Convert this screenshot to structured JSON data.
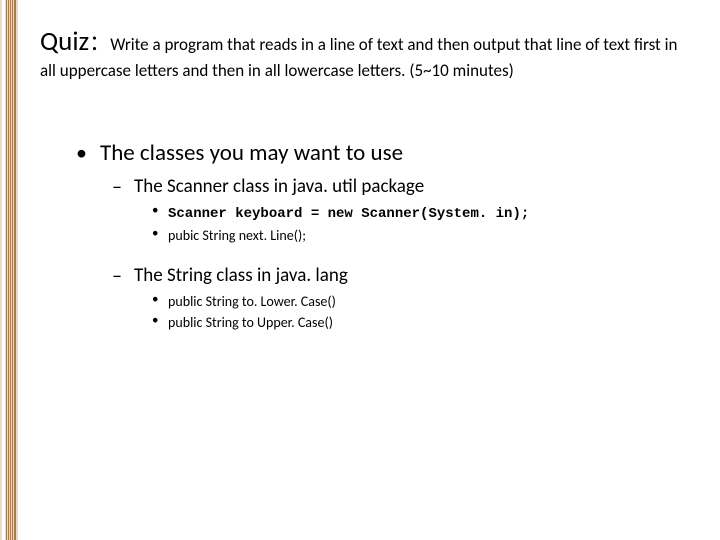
{
  "title": {
    "label": "Quiz",
    "colon": "：",
    "description": "Write a program that reads in a line of text and then output that line of text first in all uppercase letters and then in all lowercase letters. (5~10 minutes)"
  },
  "bullets": {
    "main": "The classes you may want to use",
    "sub1": {
      "head": "The Scanner class in java. util package",
      "code": "Scanner keyboard = new Scanner(System. in);",
      "item2": "pubic String next. Line();"
    },
    "sub2": {
      "head": "The String class in java. lang",
      "item1": "public String to. Lower. Case()",
      "item2": "public String to Upper. Case()"
    }
  }
}
